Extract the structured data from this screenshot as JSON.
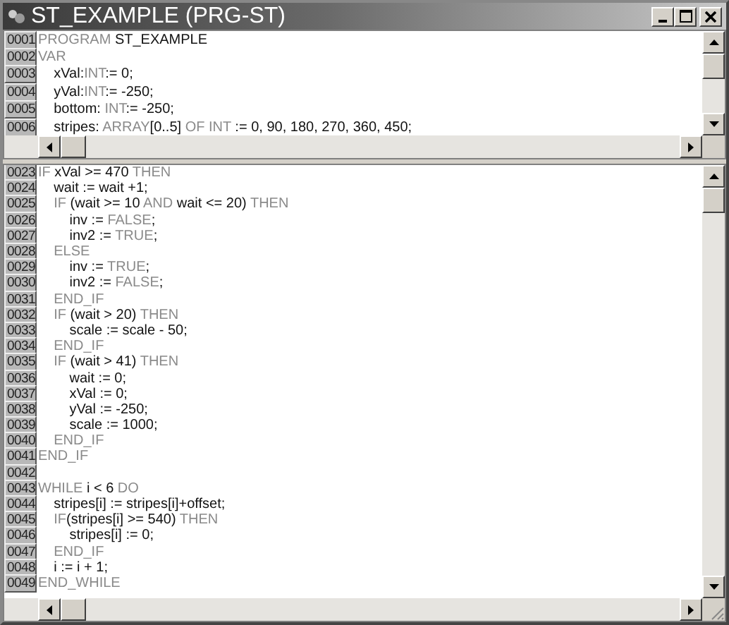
{
  "window": {
    "title": "ST_EXAMPLE (PRG-ST)",
    "buttons": [
      {
        "kind": "minimize"
      },
      {
        "kind": "maximize"
      },
      {
        "kind": "close"
      }
    ]
  },
  "declaration_pane": {
    "lines": [
      {
        "number": "0001",
        "tokens": [
          {
            "kind": "keyword",
            "text": "PROGRAM "
          },
          {
            "kind": "ident",
            "text": "ST_EXAMPLE"
          }
        ]
      },
      {
        "number": "0002",
        "tokens": [
          {
            "kind": "keyword",
            "text": "VAR"
          }
        ]
      },
      {
        "number": "0003",
        "tokens": [
          {
            "kind": "ident",
            "text": "    xVal:"
          },
          {
            "kind": "keyword",
            "text": "INT"
          },
          {
            "kind": "ident",
            "text": ":= 0;"
          }
        ]
      },
      {
        "number": "0004",
        "tokens": [
          {
            "kind": "ident",
            "text": "    yVal:"
          },
          {
            "kind": "keyword",
            "text": "INT"
          },
          {
            "kind": "ident",
            "text": ":= -250;"
          }
        ]
      },
      {
        "number": "0005",
        "tokens": [
          {
            "kind": "ident",
            "text": "    bottom: "
          },
          {
            "kind": "keyword",
            "text": "INT"
          },
          {
            "kind": "ident",
            "text": ":= -250;"
          }
        ]
      },
      {
        "number": "0006",
        "tokens": [
          {
            "kind": "ident",
            "text": "    stripes: "
          },
          {
            "kind": "keyword",
            "text": "ARRAY"
          },
          {
            "kind": "ident",
            "text": "[0..5] "
          },
          {
            "kind": "keyword",
            "text": "OF INT"
          },
          {
            "kind": "ident",
            "text": " := 0, 90, 180, 270, 360, 450;"
          }
        ]
      }
    ]
  },
  "body_pane": {
    "lines": [
      {
        "number": "0023",
        "tokens": [
          {
            "kind": "keyword",
            "text": "IF "
          },
          {
            "kind": "ident",
            "text": "xVal >= 470 "
          },
          {
            "kind": "keyword",
            "text": "THEN"
          }
        ]
      },
      {
        "number": "0024",
        "tokens": [
          {
            "kind": "ident",
            "text": "    wait := wait +1;"
          }
        ]
      },
      {
        "number": "0025",
        "tokens": [
          {
            "kind": "keyword",
            "text": "    IF "
          },
          {
            "kind": "ident",
            "text": "(wait >= 10 "
          },
          {
            "kind": "keyword",
            "text": "AND "
          },
          {
            "kind": "ident",
            "text": "wait <= 20) "
          },
          {
            "kind": "keyword",
            "text": "THEN"
          }
        ]
      },
      {
        "number": "0026",
        "tokens": [
          {
            "kind": "ident",
            "text": "        inv := "
          },
          {
            "kind": "keyword",
            "text": "FALSE"
          },
          {
            "kind": "ident",
            "text": ";"
          }
        ]
      },
      {
        "number": "0027",
        "tokens": [
          {
            "kind": "ident",
            "text": "        inv2 := "
          },
          {
            "kind": "keyword",
            "text": "TRUE"
          },
          {
            "kind": "ident",
            "text": ";"
          }
        ]
      },
      {
        "number": "0028",
        "tokens": [
          {
            "kind": "keyword",
            "text": "    ELSE"
          }
        ]
      },
      {
        "number": "0029",
        "tokens": [
          {
            "kind": "ident",
            "text": "        inv := "
          },
          {
            "kind": "keyword",
            "text": "TRUE"
          },
          {
            "kind": "ident",
            "text": ";"
          }
        ]
      },
      {
        "number": "0030",
        "tokens": [
          {
            "kind": "ident",
            "text": "        inv2 := "
          },
          {
            "kind": "keyword",
            "text": "FALSE"
          },
          {
            "kind": "ident",
            "text": ";"
          }
        ]
      },
      {
        "number": "0031",
        "tokens": [
          {
            "kind": "keyword",
            "text": "    END_IF"
          }
        ]
      },
      {
        "number": "0032",
        "tokens": [
          {
            "kind": "keyword",
            "text": "    IF "
          },
          {
            "kind": "ident",
            "text": "(wait > 20) "
          },
          {
            "kind": "keyword",
            "text": "THEN"
          }
        ]
      },
      {
        "number": "0033",
        "tokens": [
          {
            "kind": "ident",
            "text": "        scale := scale - 50;"
          }
        ]
      },
      {
        "number": "0034",
        "tokens": [
          {
            "kind": "keyword",
            "text": "    END_IF"
          }
        ]
      },
      {
        "number": "0035",
        "tokens": [
          {
            "kind": "keyword",
            "text": "    IF "
          },
          {
            "kind": "ident",
            "text": "(wait > 41) "
          },
          {
            "kind": "keyword",
            "text": "THEN"
          }
        ]
      },
      {
        "number": "0036",
        "tokens": [
          {
            "kind": "ident",
            "text": "        wait := 0;"
          }
        ]
      },
      {
        "number": "0037",
        "tokens": [
          {
            "kind": "ident",
            "text": "        xVal := 0;"
          }
        ]
      },
      {
        "number": "0038",
        "tokens": [
          {
            "kind": "ident",
            "text": "        yVal := -250;"
          }
        ]
      },
      {
        "number": "0039",
        "tokens": [
          {
            "kind": "ident",
            "text": "        scale := 1000;"
          }
        ]
      },
      {
        "number": "0040",
        "tokens": [
          {
            "kind": "keyword",
            "text": "    END_IF"
          }
        ]
      },
      {
        "number": "0041",
        "tokens": [
          {
            "kind": "keyword",
            "text": "END_IF"
          }
        ]
      },
      {
        "number": "0042"
      },
      {
        "number": "0043",
        "tokens": [
          {
            "kind": "keyword",
            "text": "WHILE "
          },
          {
            "kind": "ident",
            "text": "i < 6 "
          },
          {
            "kind": "keyword",
            "text": "DO"
          }
        ]
      },
      {
        "number": "0044",
        "tokens": [
          {
            "kind": "ident",
            "text": "    stripes[i] := stripes[i]+offset;"
          }
        ]
      },
      {
        "number": "0045",
        "tokens": [
          {
            "kind": "keyword",
            "text": "    IF"
          },
          {
            "kind": "ident",
            "text": "(stripes[i] >= 540) "
          },
          {
            "kind": "keyword",
            "text": "THEN"
          }
        ]
      },
      {
        "number": "0046",
        "tokens": [
          {
            "kind": "ident",
            "text": "        stripes[i] := 0;"
          }
        ]
      },
      {
        "number": "0047",
        "tokens": [
          {
            "kind": "keyword",
            "text": "    END_IF"
          }
        ]
      },
      {
        "number": "0048",
        "tokens": [
          {
            "kind": "ident",
            "text": "    i := i + 1;"
          }
        ]
      },
      {
        "number": "0049",
        "tokens": [
          {
            "kind": "keyword",
            "text": "END_WHILE"
          }
        ]
      }
    ]
  }
}
